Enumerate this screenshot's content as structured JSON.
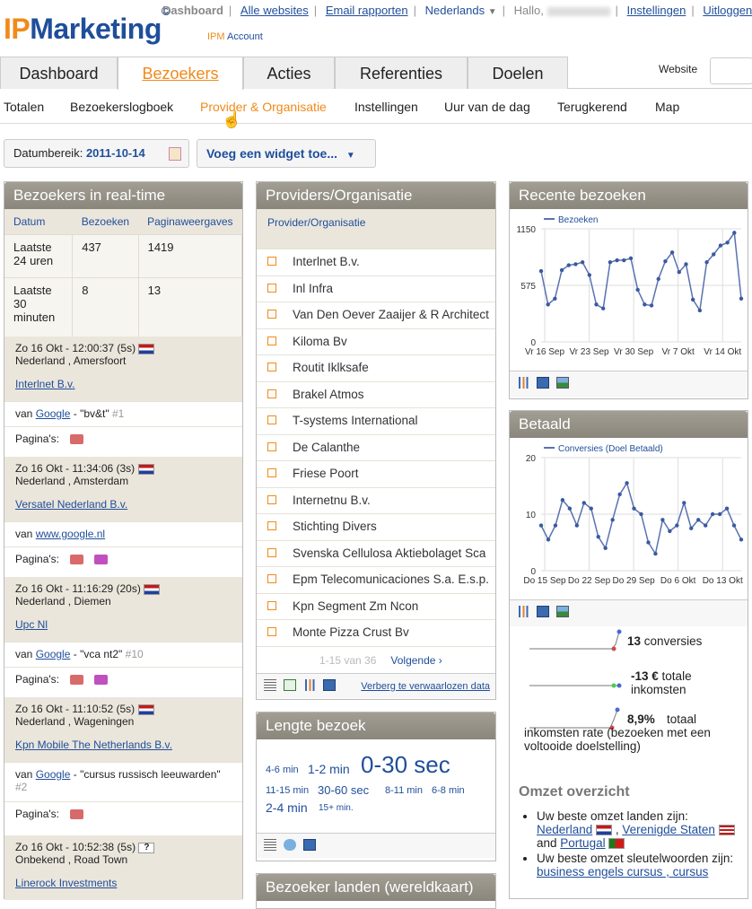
{
  "header": {
    "logo_ip": "IP",
    "logo_marketing": "Marketing",
    "logo_mark": "©",
    "account_ipm": "IPM",
    "account_label": "Account",
    "links": {
      "dashboard": "Dashboard",
      "alle_websites": "Alle websites",
      "email": "Email rapporten",
      "language": "Nederlands",
      "greeting": "Hallo,",
      "settings": "Instellingen",
      "logout": "Uitloggen"
    },
    "website_label": "Website"
  },
  "main_tabs": [
    "Dashboard",
    "Bezoekers",
    "Acties",
    "Referenties",
    "Doelen"
  ],
  "sub_tabs": [
    "Totalen",
    "Bezoekerslogboek",
    "Provider & Organisatie",
    "Instellingen",
    "Uur van de dag",
    "Terugkerend",
    "Map"
  ],
  "toolbar": {
    "date_label": "Datumbereik:",
    "date_value": "2011-10-14",
    "widget_button": "Voeg een widget toe..."
  },
  "realtime": {
    "title": "Bezoekers in real-time",
    "columns": [
      "Datum",
      "Bezoeken",
      "Paginaweergaves"
    ],
    "rows": [
      [
        "Laatste 24 uren",
        "437",
        "1419"
      ],
      [
        "Laatste 30 minuten",
        "8",
        "13"
      ]
    ],
    "visits": [
      {
        "time": "Zo 16 Okt - 12:00:37 (5s)",
        "location": "Nederland , Amersfoort",
        "org": "Interlnet B.v.",
        "ref_prefix": "van",
        "ref_link": "Google",
        "ref_kw": "- \"bv&t\"",
        "ref_rank": "#1",
        "pages_label": "Pagina's:"
      },
      {
        "time": "Zo 16 Okt - 11:34:06 (3s)",
        "location": "Nederland , Amsterdam",
        "org": "Versatel Nederland B.v.",
        "ref_prefix": "van",
        "ref_link": "www.google.nl",
        "ref_kw": "",
        "ref_rank": "",
        "pages_label": "Pagina's:"
      },
      {
        "time": "Zo 16 Okt - 11:16:29 (20s)",
        "location": "Nederland , Diemen",
        "org": "Upc Nl",
        "ref_prefix": "van",
        "ref_link": "Google",
        "ref_kw": "- \"vca nt2\"",
        "ref_rank": "#10",
        "pages_label": "Pagina's:"
      },
      {
        "time": "Zo 16 Okt - 11:10:52 (5s)",
        "location": "Nederland , Wageningen",
        "org": "Kpn Mobile The Netherlands B.v.",
        "ref_prefix": "van",
        "ref_link": "Google",
        "ref_kw": "- \"cursus russisch leeuwarden\"",
        "ref_rank": "#2",
        "pages_label": "Pagina's:"
      },
      {
        "time": "Zo 16 Okt - 10:52:38 (5s)",
        "location": "Onbekend , Road Town",
        "org": "Linerock Investments",
        "flag": "?"
      }
    ]
  },
  "providers": {
    "title": "Providers/Organisatie",
    "column": "Provider/Organisatie",
    "items": [
      "Interlnet B.v.",
      "Inl Infra",
      "Van Den Oever Zaaijer & R Architect",
      "Kiloma Bv",
      "Routit Iklksafe",
      "Brakel Atmos",
      "T-systems International",
      "De Calanthe",
      "Friese Poort",
      "Internetnu B.v.",
      "Stichting Divers",
      "Svenska Cellulosa Aktiebolaget Sca",
      "Epm Telecomunicaciones S.a. E.s.p.",
      "Kpn Segment Zm Ncon",
      "Monte Pizza Crust Bv"
    ],
    "pager_count": "1-15 van 36",
    "pager_next": "Volgende ›",
    "hide_link": "Verberg te verwaarlozen data"
  },
  "lengte": {
    "title": "Lengte bezoek",
    "tags": [
      "4-6 min",
      "1-2 min",
      "0-30 sec",
      "11-15 min",
      "30-60 sec",
      "8-11 min",
      "6-8 min",
      "2-4 min",
      "15+ min."
    ]
  },
  "landen": {
    "title": "Bezoeker landen (wereldkaart)"
  },
  "recent": {
    "title": "Recente bezoeken"
  },
  "betaald": {
    "title": "Betaald",
    "stats": [
      {
        "value": "13",
        "label": "conversies"
      },
      {
        "value": "-13 €",
        "label": "totale inkomsten"
      },
      {
        "value": "8,9%",
        "label": "totaal inkomsten rate (bezoeken met een voltooide doelstelling)"
      }
    ],
    "omzet_title": "Omzet overzicht",
    "omzet_countries_label": "Uw beste omzet landen zijn:",
    "countries": [
      "Nederland",
      "Verenigde Staten",
      "Portugal"
    ],
    "and": "and",
    "omzet_keywords_label": "Uw beste omzet sleutelwoorden zijn:",
    "keyword_partial": "business engels cursus , cursus"
  },
  "chart_data": [
    {
      "type": "line",
      "title": "Recente bezoeken",
      "series": [
        {
          "name": "Bezoeken",
          "values": [
            720,
            380,
            440,
            730,
            780,
            790,
            810,
            680,
            380,
            340,
            810,
            830,
            830,
            850,
            530,
            380,
            370,
            640,
            820,
            910,
            710,
            790,
            430,
            320,
            810,
            890,
            980,
            1010,
            1110,
            440
          ]
        }
      ],
      "x_ticks": [
        "Vr 16 Sep",
        "Vr 23 Sep",
        "Vr 30 Sep",
        "Vr 7 Okt",
        "Vr 14 Okt"
      ],
      "y_ticks": [
        0,
        575,
        1150
      ],
      "ylim": [
        0,
        1150
      ]
    },
    {
      "type": "line",
      "title": "Betaald",
      "series": [
        {
          "name": "Conversies (Doel Betaald)",
          "values": [
            8,
            5.5,
            8,
            12.5,
            11,
            8,
            12,
            11,
            6,
            4,
            9,
            13.5,
            15.5,
            11,
            10,
            5,
            3,
            9,
            7,
            8,
            12,
            7.5,
            9,
            8,
            10,
            10,
            11,
            8,
            5.5
          ]
        }
      ],
      "x_ticks": [
        "Do 15 Sep",
        "Do 22 Sep",
        "Do 29 Sep",
        "Do 6 Okt",
        "Do 13 Okt"
      ],
      "y_ticks": [
        0,
        10,
        20
      ],
      "ylim": [
        0,
        20
      ]
    }
  ]
}
